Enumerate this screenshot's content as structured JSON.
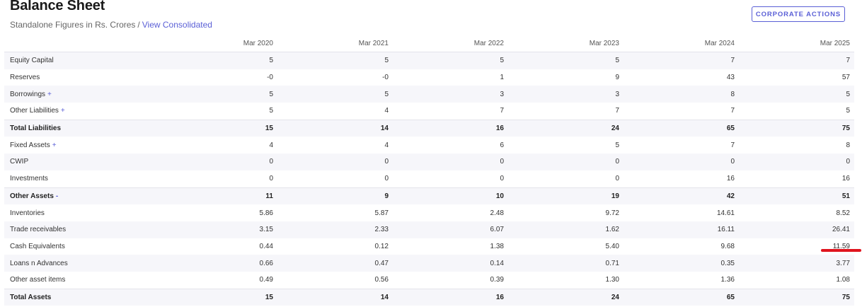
{
  "header": {
    "title": "Balance Sheet",
    "subtitle_text": "Standalone Figures in Rs. Crores",
    "subtitle_sep": "/",
    "subtitle_link": "View Consolidated",
    "action_button": "CORPORATE ACTIONS"
  },
  "table": {
    "columns": [
      "Mar 2020",
      "Mar 2021",
      "Mar 2022",
      "Mar 2023",
      "Mar 2024",
      "Mar 2025"
    ],
    "rows": [
      {
        "label": "Equity Capital",
        "expand": "",
        "values": [
          "5",
          "5",
          "5",
          "5",
          "7",
          "7"
        ]
      },
      {
        "label": "Reserves",
        "expand": "",
        "values": [
          "-0",
          "-0",
          "1",
          "9",
          "43",
          "57"
        ]
      },
      {
        "label": "Borrowings",
        "expand": "+",
        "values": [
          "5",
          "5",
          "3",
          "3",
          "8",
          "5"
        ]
      },
      {
        "label": "Other Liabilities",
        "expand": "+",
        "values": [
          "5",
          "4",
          "7",
          "7",
          "7",
          "5"
        ]
      },
      {
        "label": "Total Liabilities",
        "expand": "",
        "values": [
          "15",
          "14",
          "16",
          "24",
          "65",
          "75"
        ]
      },
      {
        "label": "Fixed Assets",
        "expand": "+",
        "values": [
          "4",
          "4",
          "6",
          "5",
          "7",
          "8"
        ]
      },
      {
        "label": "CWIP",
        "expand": "",
        "values": [
          "0",
          "0",
          "0",
          "0",
          "0",
          "0"
        ]
      },
      {
        "label": "Investments",
        "expand": "",
        "values": [
          "0",
          "0",
          "0",
          "0",
          "16",
          "16"
        ]
      },
      {
        "label": "Other Assets",
        "expand": "-",
        "values": [
          "11",
          "9",
          "10",
          "19",
          "42",
          "51"
        ]
      },
      {
        "label": "Inventories",
        "expand": "",
        "values": [
          "5.86",
          "5.87",
          "2.48",
          "9.72",
          "14.61",
          "8.52"
        ]
      },
      {
        "label": "Trade receivables",
        "expand": "",
        "values": [
          "3.15",
          "2.33",
          "6.07",
          "1.62",
          "16.11",
          "26.41"
        ]
      },
      {
        "label": "Cash Equivalents",
        "expand": "",
        "values": [
          "0.44",
          "0.12",
          "1.38",
          "5.40",
          "9.68",
          "11.59"
        ]
      },
      {
        "label": "Loans n Advances",
        "expand": "",
        "values": [
          "0.66",
          "0.47",
          "0.14",
          "0.71",
          "0.35",
          "3.77"
        ]
      },
      {
        "label": "Other asset items",
        "expand": "",
        "values": [
          "0.49",
          "0.56",
          "0.39",
          "1.30",
          "1.36",
          "1.08"
        ]
      },
      {
        "label": "Total Assets",
        "expand": "",
        "values": [
          "15",
          "14",
          "16",
          "24",
          "65",
          "75"
        ]
      }
    ]
  },
  "colors": {
    "accent": "#5a5fd6",
    "stripe": "#f6f6fa",
    "annotation": "#e0141e"
  }
}
